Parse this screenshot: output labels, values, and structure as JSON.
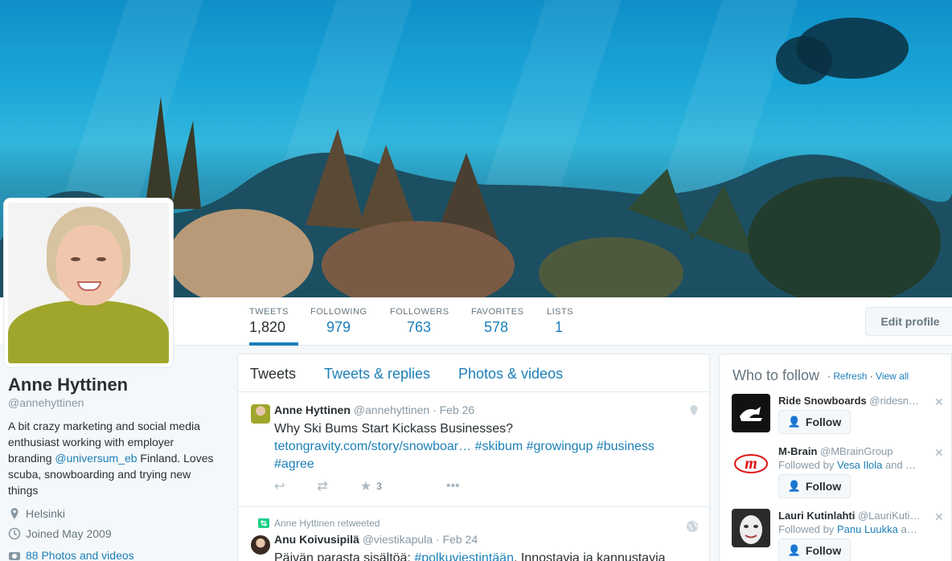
{
  "profile": {
    "name": "Anne Hyttinen",
    "handle": "@annehyttinen",
    "bio_pre": "A bit crazy marketing and social media enthusiast working with employer branding ",
    "bio_link": "@universum_eb",
    "bio_post": " Finland. Loves scuba, snowboarding and trying new things",
    "location": "Helsinki",
    "joined": "Joined May 2009",
    "photos": "88 Photos and videos"
  },
  "nav": {
    "stats": [
      {
        "label": "TWEETS",
        "value": "1,820"
      },
      {
        "label": "FOLLOWING",
        "value": "979"
      },
      {
        "label": "FOLLOWERS",
        "value": "763"
      },
      {
        "label": "FAVORITES",
        "value": "578"
      },
      {
        "label": "LISTS",
        "value": "1"
      }
    ],
    "edit_profile": "Edit profile"
  },
  "timeline": {
    "tabs": [
      "Tweets",
      "Tweets & replies",
      "Photos & videos"
    ],
    "tweets": [
      {
        "name": "Anne Hyttinen",
        "handle": "@annehyttinen",
        "time": "Feb 26",
        "line1": "Why Ski Bums Start Kickass Businesses?",
        "link": "tetongravity.com/story/snowboar…",
        "tags": [
          "#skibum",
          "#growingup",
          "#business",
          "#agree"
        ],
        "favorites": "3"
      },
      {
        "retweeted_by": "Anne Hyttinen retweeted",
        "name": "Anu Koivusipilä",
        "handle": "@viestikapula",
        "time": "Feb 24",
        "text_pre": "Päivän parasta sisältöä: ",
        "tag": "#polkuviestintään",
        "text_post": ". Innostavia ja kannustavia"
      }
    ]
  },
  "who_to_follow": {
    "title": "Who to follow",
    "refresh": "Refresh",
    "view_all": "View all",
    "follow_label": "Follow",
    "suggestions": [
      {
        "name": "Ride Snowboards",
        "handle": "@ridesn…",
        "followed_by": ""
      },
      {
        "name": "M-Brain",
        "handle": "@MBrainGroup",
        "followed_by_pre": "Followed by ",
        "followed_by_link": "Vesa Ilola",
        "followed_by_post": " and …"
      },
      {
        "name": "Lauri Kutinlahti",
        "handle": "@LauriKuti…",
        "followed_by_pre": "Followed by ",
        "followed_by_link": "Panu Luukka",
        "followed_by_post": " a…"
      }
    ]
  },
  "colors": {
    "link": "#1b7fb8",
    "text": "#292f33",
    "muted": "#8899a6"
  }
}
